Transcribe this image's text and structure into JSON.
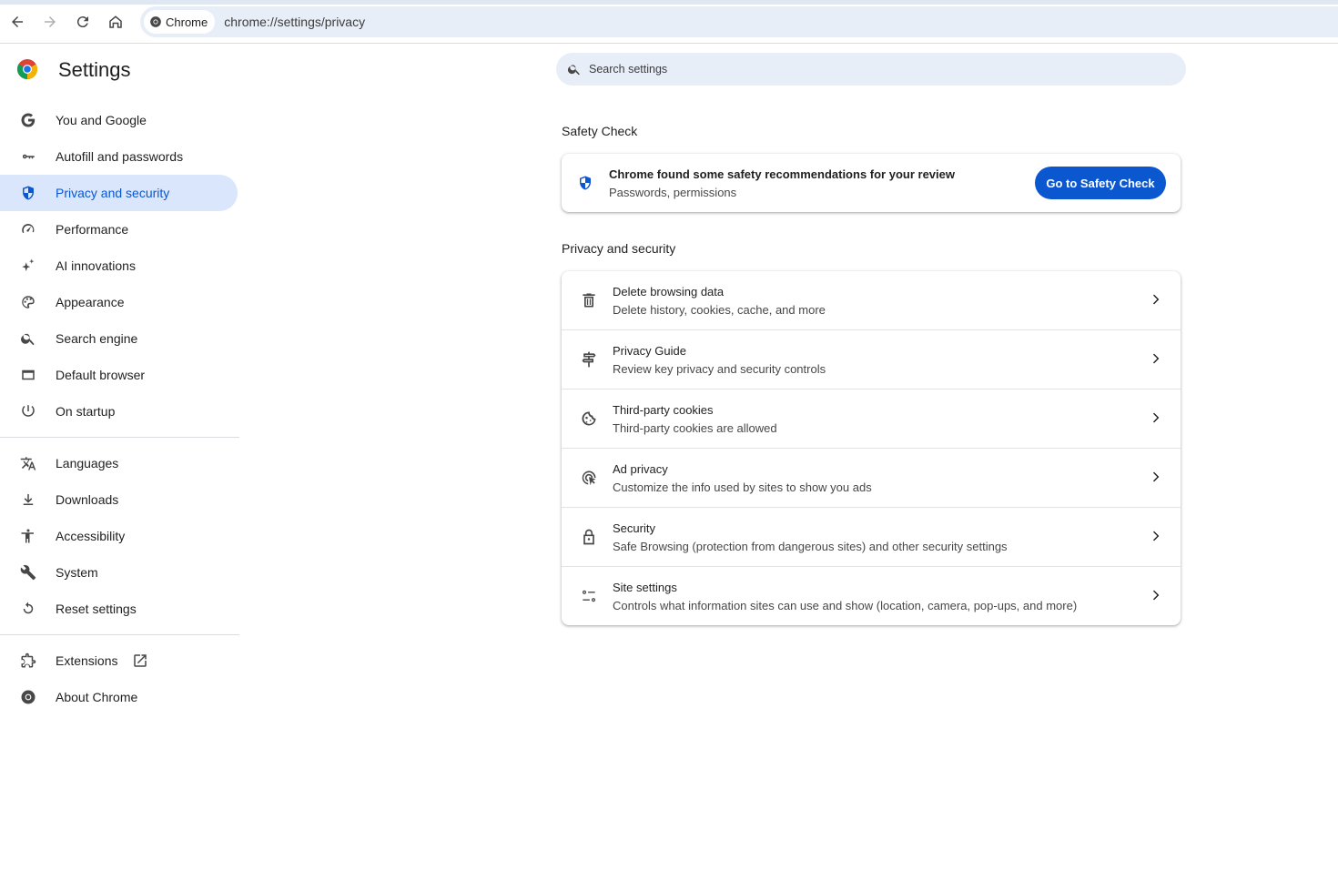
{
  "browser": {
    "chip_label": "Chrome",
    "url": "chrome://settings/privacy"
  },
  "header": {
    "title": "Settings",
    "search_placeholder": "Search settings"
  },
  "sidebar": {
    "group1": [
      {
        "label": "You and Google",
        "icon": "google-g-icon"
      },
      {
        "label": "Autofill and passwords",
        "icon": "key-icon"
      },
      {
        "label": "Privacy and security",
        "icon": "shield-icon",
        "active": true
      },
      {
        "label": "Performance",
        "icon": "speedometer-icon"
      },
      {
        "label": "AI innovations",
        "icon": "sparkle-icon"
      },
      {
        "label": "Appearance",
        "icon": "palette-icon"
      },
      {
        "label": "Search engine",
        "icon": "search-icon"
      },
      {
        "label": "Default browser",
        "icon": "browser-window-icon"
      },
      {
        "label": "On startup",
        "icon": "power-icon"
      }
    ],
    "group2": [
      {
        "label": "Languages",
        "icon": "translate-icon"
      },
      {
        "label": "Downloads",
        "icon": "download-icon"
      },
      {
        "label": "Accessibility",
        "icon": "accessibility-icon"
      },
      {
        "label": "System",
        "icon": "wrench-icon"
      },
      {
        "label": "Reset settings",
        "icon": "reset-icon"
      }
    ],
    "group3": [
      {
        "label": "Extensions",
        "icon": "puzzle-icon"
      },
      {
        "label": "About Chrome",
        "icon": "chrome-icon"
      }
    ]
  },
  "safety_check": {
    "section_title": "Safety Check",
    "title": "Chrome found some safety recommendations for your review",
    "subtitle": "Passwords, permissions",
    "button_label": "Go to Safety Check"
  },
  "privacy": {
    "section_title": "Privacy and security",
    "rows": [
      {
        "title": "Delete browsing data",
        "subtitle": "Delete history, cookies, cache, and more",
        "icon": "trash-icon"
      },
      {
        "title": "Privacy Guide",
        "subtitle": "Review key privacy and security controls",
        "icon": "signpost-icon"
      },
      {
        "title": "Third-party cookies",
        "subtitle": "Third-party cookies are allowed",
        "icon": "cookie-icon"
      },
      {
        "title": "Ad privacy",
        "subtitle": "Customize the info used by sites to show you ads",
        "icon": "ad-privacy-icon"
      },
      {
        "title": "Security",
        "subtitle": "Safe Browsing (protection from dangerous sites) and other security settings",
        "icon": "lock-icon"
      },
      {
        "title": "Site settings",
        "subtitle": "Controls what information sites can use and show (location, camera, pop-ups, and more)",
        "icon": "tune-icon"
      }
    ]
  },
  "colors": {
    "accent": "#0b57d0",
    "active_bg": "#d9e6fb",
    "omnibox_bg": "#e8eef8"
  }
}
